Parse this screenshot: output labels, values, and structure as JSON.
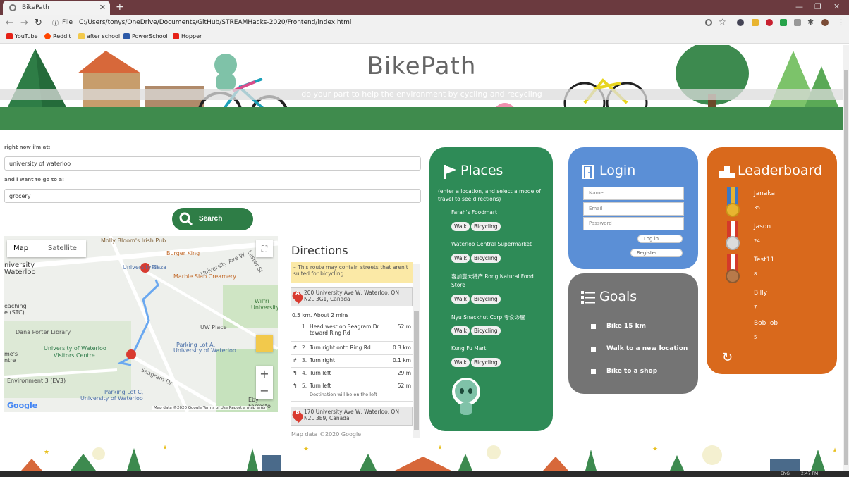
{
  "browser": {
    "tab_title": "BikePath",
    "new_tab": "+",
    "address_file": "File",
    "address_url": "C:/Users/tonys/OneDrive/Documents/GitHub/STREAMHacks-2020/Frontend/index.html",
    "bookmarks": [
      {
        "label": "YouTube",
        "color": "#e62117"
      },
      {
        "label": "Reddit",
        "color": "#ff4500"
      },
      {
        "label": "after school",
        "color": "#f2c94c"
      },
      {
        "label": "PowerSchool",
        "color": "#2d5aa8"
      },
      {
        "label": "Hopper",
        "color": "#e62117"
      }
    ]
  },
  "hero": {
    "title": "BikePath",
    "subtitle": "do your part to help the environment by cycling and recycling"
  },
  "form": {
    "from_label": "right now i'm at:",
    "from_value": "university of waterloo",
    "to_label": "and i want to go to a:",
    "to_value": "grocery",
    "search_label": "Search"
  },
  "map": {
    "tab_map": "Map",
    "tab_satellite": "Satellite",
    "labels": [
      "Molly Bloom's Irish Pub",
      "Burger King",
      "University Sh",
      "Plaza",
      "Marble Slab Creamery",
      "University Ave W",
      "Lester St",
      "Wilfri",
      "University",
      "UW Place",
      "Dana Porter Library",
      "University of Waterloo",
      "Visitors Centre",
      "Parking Lot A,",
      "University of Waterloo",
      "Seagram Dr",
      "Environment 3 (EV3)",
      "Parking Lot C,",
      "University of Waterloo",
      "Eby Farmsto",
      "niversity",
      "Waterloo",
      "eaching",
      "e (STC)",
      "me's",
      "ntre"
    ],
    "google": "Google",
    "footer": "Map data ©2020 Google   Terms of Use   Report a map error"
  },
  "directions": {
    "title": "Directions",
    "warning": "– This route may contain streets that aren't suited for bicycling.",
    "start_pin": "A",
    "start_address": "200 University Ave W, Waterloo, ON N2L 3G1, Canada",
    "summary": "0.5 km. About 2 mins",
    "steps": [
      {
        "icon": "",
        "num": "1.",
        "text": "Head west on Seagram Dr toward Ring Rd",
        "dist": "52 m"
      },
      {
        "icon": "↱",
        "num": "2.",
        "text": "Turn right onto Ring Rd",
        "dist": "0.3 km"
      },
      {
        "icon": "↱",
        "num": "3.",
        "text": "Turn right",
        "dist": "0.1 km"
      },
      {
        "icon": "↰",
        "num": "4.",
        "text": "Turn left",
        "dist": "29 m"
      },
      {
        "icon": "↰",
        "num": "5.",
        "text": "Turn left",
        "dist": "52 m"
      }
    ],
    "step5_note": "Destination will be on the left",
    "end_pin": "B",
    "end_address": "170 University Ave W, Waterloo, ON N2L 3E9, Canada",
    "map_data": "Map data ©2020 Google"
  },
  "places": {
    "title": "Places",
    "hint": "(enter a location, and select a mode of travel to see directions)",
    "walk": "Walk",
    "bicycling": "Bicycling",
    "items": [
      "Farah's Foodmart",
      "Waterloo Central Supermarket",
      "容加豐大特产 Rong Natural Food Store",
      "Nyu Snackhut Corp.零食の屋",
      "Kung Fu Mart"
    ]
  },
  "login": {
    "title": "Login",
    "name_placeholder": "Name",
    "email_placeholder": "Email",
    "password_placeholder": "Password",
    "login_btn": "Log in",
    "register_btn": "Register"
  },
  "goals": {
    "title": "Goals",
    "items": [
      "Bike 15 km",
      "Walk to a new location",
      "Bike to a shop"
    ]
  },
  "leaderboard": {
    "title": "Leaderboard",
    "entries": [
      {
        "name": "Janaka",
        "score": "35"
      },
      {
        "name": "Jason",
        "score": "24"
      },
      {
        "name": "Test11",
        "score": "8"
      },
      {
        "name": "Billy",
        "score": "7"
      },
      {
        "name": "Bob Job",
        "score": "5"
      }
    ]
  },
  "taskbar": {
    "lang": "ENG",
    "time": "2:47 PM"
  },
  "colors": {
    "places": "#2e8b57",
    "login": "#5b8fd6",
    "goals": "#747474",
    "leaderboard": "#d9691c",
    "search": "#2e7d46"
  }
}
